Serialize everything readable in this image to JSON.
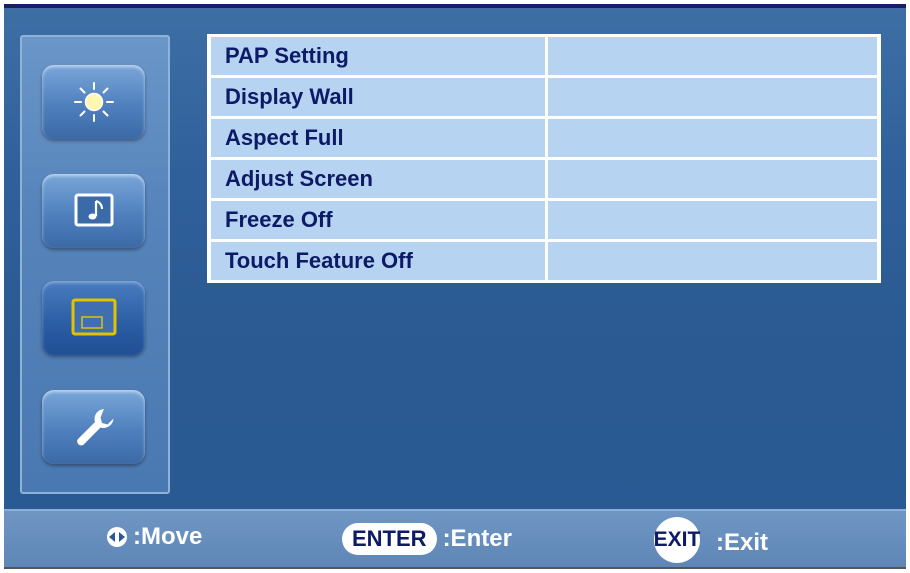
{
  "menu": {
    "items": [
      {
        "label": "PAP Setting",
        "value": ""
      },
      {
        "label": "Display Wall",
        "value": ""
      },
      {
        "label": "Aspect Full",
        "value": ""
      },
      {
        "label": "Adjust Screen",
        "value": ""
      },
      {
        "label": "Freeze Off",
        "value": ""
      },
      {
        "label": "Touch Feature Off",
        "value": ""
      }
    ]
  },
  "sidebar": {
    "items": [
      {
        "icon": "brightness-sun-icon"
      },
      {
        "icon": "music-note-icon"
      },
      {
        "icon": "display-screen-icon",
        "selected": true
      },
      {
        "icon": "wrench-icon"
      }
    ]
  },
  "footer": {
    "move_label": ":Move",
    "enter_key": "ENTER",
    "enter_label": ":Enter",
    "exit_key": "EXIT",
    "exit_label": ":Exit"
  },
  "colors": {
    "background": "#2b5a92",
    "menu_cell": "#b6d3f1",
    "menu_text": "#0d1a66",
    "selected_frame": "#e2c300"
  }
}
